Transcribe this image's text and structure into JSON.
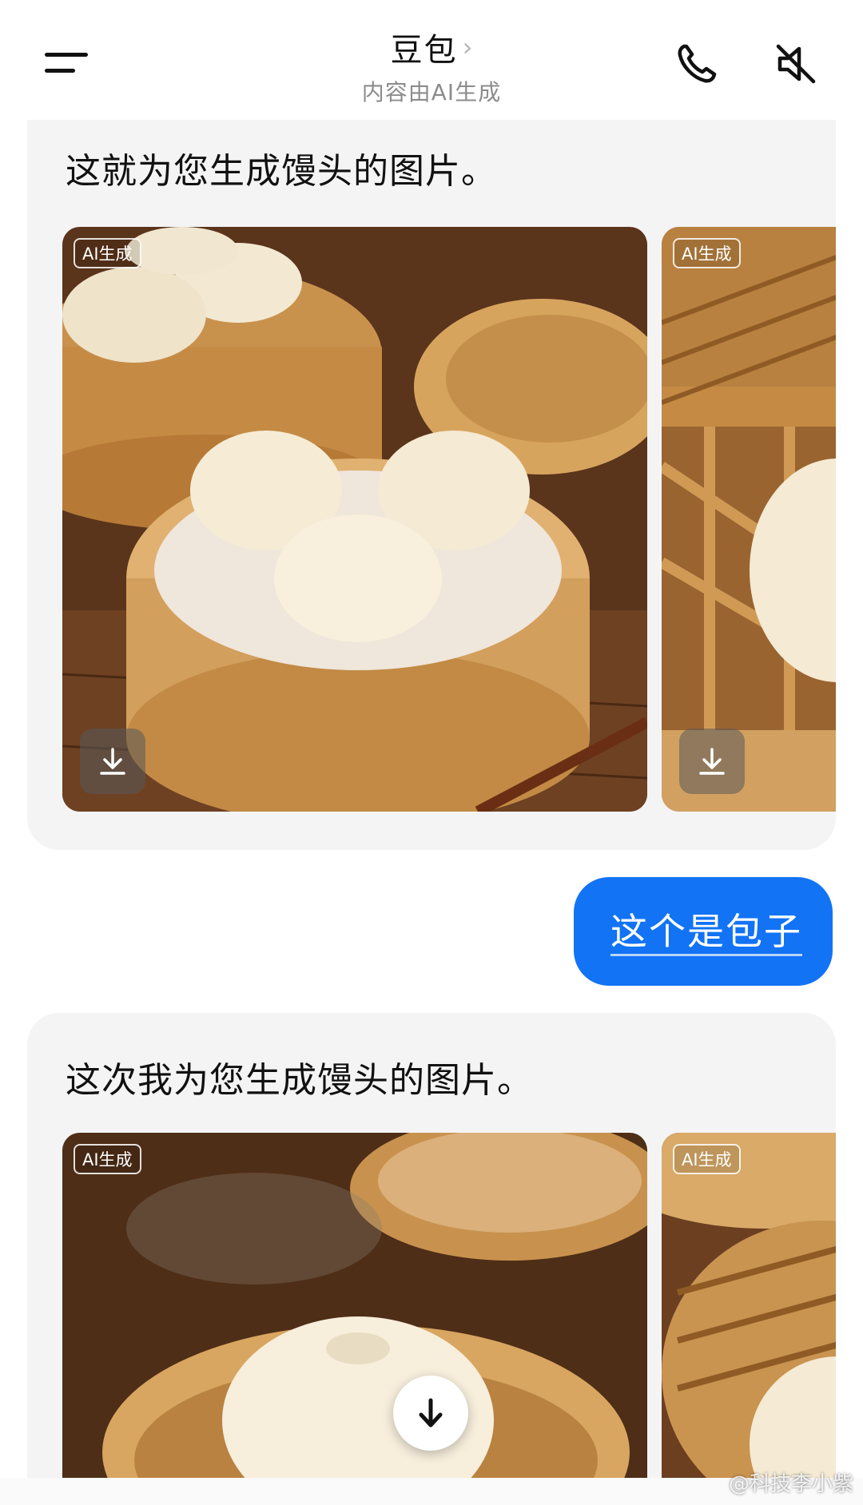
{
  "header": {
    "title": "豆包",
    "title_chevron": "›",
    "subtitle": "内容由AI生成",
    "menu_icon": "menu-icon",
    "call_icon": "phone-icon",
    "mute_icon": "speaker-muted-icon"
  },
  "messages": [
    {
      "role": "assistant",
      "text": "这就为您生成馒头的图片。",
      "images": [
        {
          "tag": "AI生成",
          "subject": "steamed buns in bamboo steamer"
        },
        {
          "tag": "AI生成",
          "subject": "steamed bun close-up in bamboo steamer"
        }
      ]
    },
    {
      "role": "user",
      "text": "这个是包子"
    },
    {
      "role": "assistant",
      "text": "这次我为您生成馒头的图片。",
      "images": [
        {
          "tag": "AI生成",
          "subject": "steaming bun in bamboo steamer"
        },
        {
          "tag": "AI生成",
          "subject": "bun in woven bamboo basket"
        }
      ]
    }
  ],
  "download_icon": "download-icon",
  "scroll_down_icon": "arrow-down-icon",
  "watermark": "@科技李小紫",
  "colors": {
    "accent_blue": "#1273f5",
    "card_bg": "#f4f4f5",
    "bamboo": "#d9a860",
    "bun": "#f6ecd6",
    "wood": "#6b3f20"
  }
}
